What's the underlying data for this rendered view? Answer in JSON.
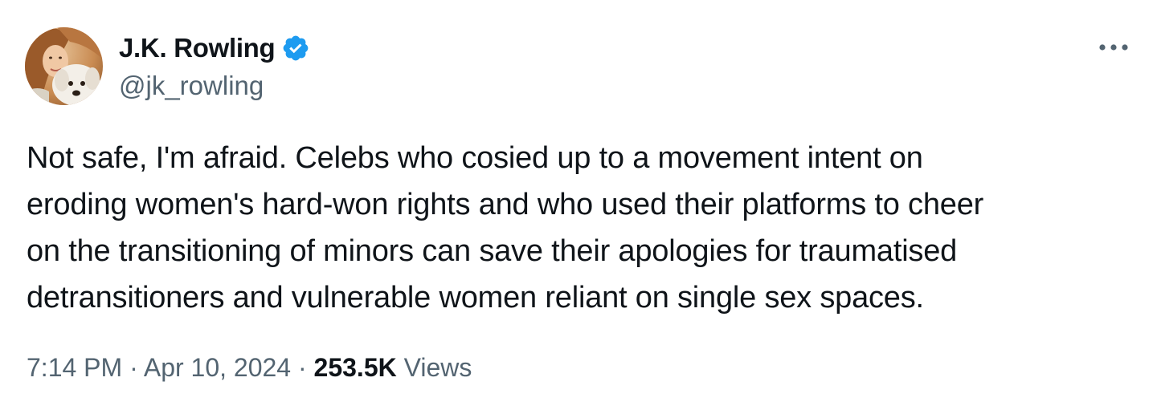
{
  "author": {
    "display_name": "J.K. Rowling",
    "handle": "@jk_rowling",
    "verified": true,
    "verified_color": "#1d9bf0"
  },
  "tweet": {
    "text": "Not safe, I'm afraid. Celebs who cosied up to a movement intent on\neroding women's hard-won rights and who used their platforms to cheer\non the transitioning of minors can save their apologies for traumatised\ndetransitioners and vulnerable women reliant on single sex spaces."
  },
  "meta": {
    "time": "7:14 PM",
    "separator": "·",
    "date": "Apr 10, 2024",
    "views_count": "253.5K",
    "views_label": "Views"
  },
  "icons": {
    "avatar": "profile-photo-with-dog",
    "verified": "verified-badge-icon",
    "more": "more-horizontal-icon"
  },
  "colors": {
    "text_primary": "#0f1419",
    "text_secondary": "#536471",
    "background": "#ffffff"
  }
}
